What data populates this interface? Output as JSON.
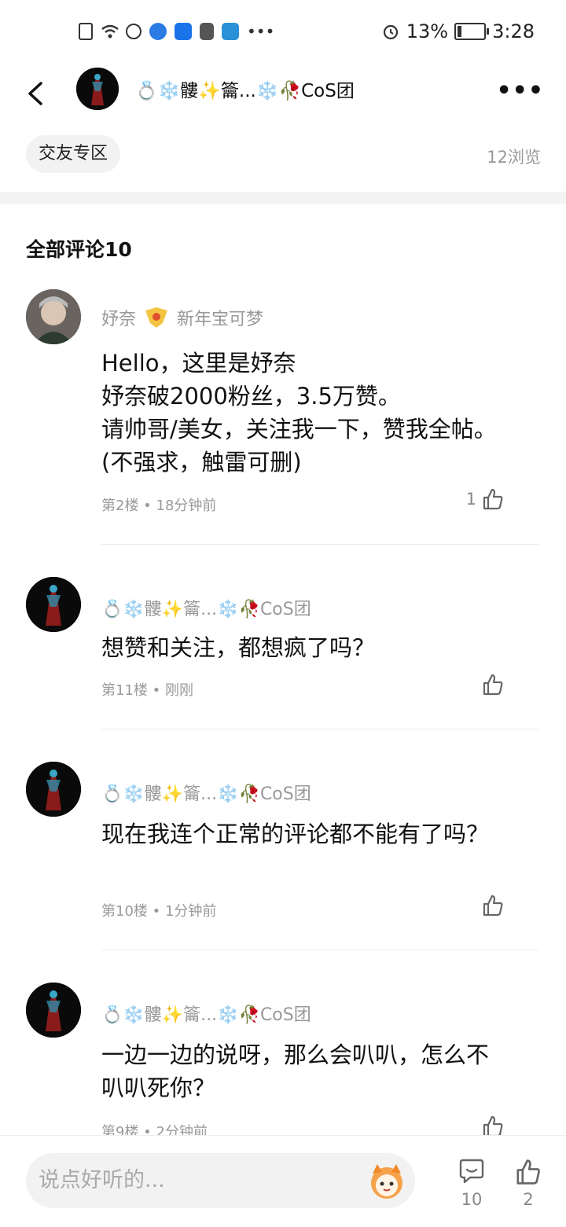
{
  "status_bar": {
    "battery": "13%",
    "time": "3:28"
  },
  "header": {
    "title": "💍❄️髏✨籥...❄️🥀CoS团",
    "more": "•••"
  },
  "post": {
    "tag": "交友专区",
    "views": "12浏览"
  },
  "comments_section": {
    "title": "全部评论10"
  },
  "comments": [
    {
      "user": "妤奈",
      "badge_name": "新年宝可梦",
      "text": "Hello，这里是妤奈\n妤奈破2000粉丝，3.5万赞。\n请帅哥/美女，关注我一下，赞我全帖。(不强求，触雷可删)",
      "meta": "第2楼 • 18分钟前",
      "likes": "1"
    },
    {
      "user": "💍❄️髏✨籥...❄️🥀CoS团",
      "text": "想赞和关注，都想疯了吗？",
      "meta": "第11楼 • 刚刚",
      "likes": ""
    },
    {
      "user": "💍❄️髏✨籥...❄️🥀CoS团",
      "text": "现在我连个正常的评论都不能有了吗？",
      "meta": "第10楼 • 1分钟前",
      "likes": ""
    },
    {
      "user": "💍❄️髏✨籥...❄️🥀CoS团",
      "text": "一边一边的说呀，那么会叭叭，怎么不叭叭死你？",
      "meta": "第9楼 • 2分钟前",
      "likes": ""
    }
  ],
  "bottom_bar": {
    "placeholder": "说点好听的...",
    "comment_count": "10",
    "like_count": "2"
  },
  "colors": {
    "muted": "#999999",
    "tag_bg": "#f2f2f2",
    "avatar_bg": "#0a0a0a"
  }
}
